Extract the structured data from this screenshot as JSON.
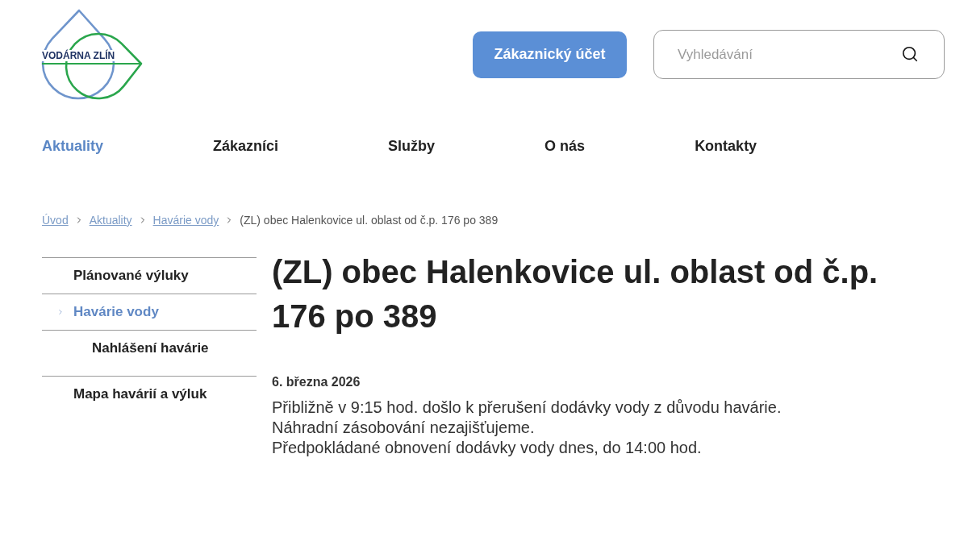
{
  "header": {
    "logo_text": "VODÁRNA ZLÍN",
    "account_button": "Zákaznický účet",
    "search": {
      "placeholder": "Vyhledávání"
    }
  },
  "nav": [
    {
      "label": "Aktuality",
      "selected": true
    },
    {
      "label": "Zákazníci",
      "selected": false
    },
    {
      "label": "Služby",
      "selected": false
    },
    {
      "label": "O nás",
      "selected": false
    },
    {
      "label": "Kontakty",
      "selected": false
    }
  ],
  "breadcrumb": [
    {
      "label": "Úvod",
      "kind": "link"
    },
    {
      "label": "Aktuality",
      "kind": "link"
    },
    {
      "label": "Havárie vody",
      "kind": "link"
    },
    {
      "label": "(ZL) obec Halenkovice ul. oblast od č.p. 176 po 389",
      "kind": "current"
    }
  ],
  "sidebar": {
    "items": [
      {
        "label": "Plánované výluky",
        "selected": false
      },
      {
        "label": "Havárie vody",
        "selected": true,
        "children": [
          {
            "label": "Nahlášení havárie",
            "selected": false
          }
        ]
      },
      {
        "label": "Mapa havárií a výluk",
        "selected": false
      }
    ]
  },
  "article": {
    "title": "(ZL) obec Halenkovice ul. oblast od č.p. 176 po 389",
    "date": "6. března 2026",
    "body": [
      "Přibližně v 9:15 hod. došlo k přerušení dodávky vody z důvodu havárie.",
      "Náhradní zásobování nezajišťujeme.",
      "Předpokládané obnovení dodávky vody dnes, do 14:00 hod."
    ]
  }
}
